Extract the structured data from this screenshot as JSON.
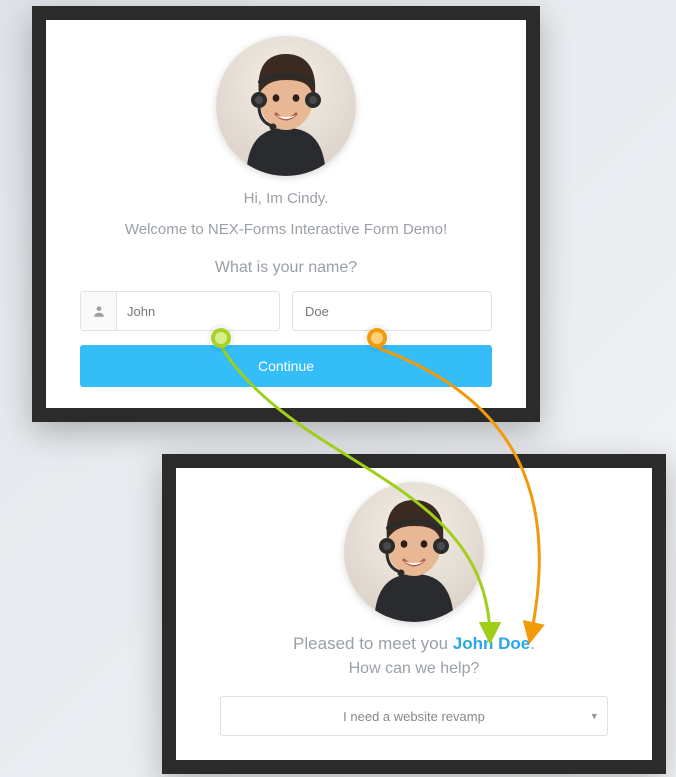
{
  "colors": {
    "accent_blue": "#34bdf7",
    "highlight_text": "#2aa7e6",
    "arrow_green": "#a0cf1a",
    "arrow_orange": "#f29a0a"
  },
  "panel1": {
    "greeting_line1": "Hi, Im Cindy.",
    "greeting_line2": "Welcome to NEX-Forms Interactive Form Demo!",
    "question": "What is your name?",
    "first_name_value": "John",
    "last_name_value": "Doe",
    "continue_label": "Continue"
  },
  "panel2": {
    "greet_prefix": "Pleased to meet you ",
    "greet_name": "John Doe",
    "greet_suffix": ".",
    "help_question": "How can we help?",
    "select_value": "I need a website revamp"
  }
}
